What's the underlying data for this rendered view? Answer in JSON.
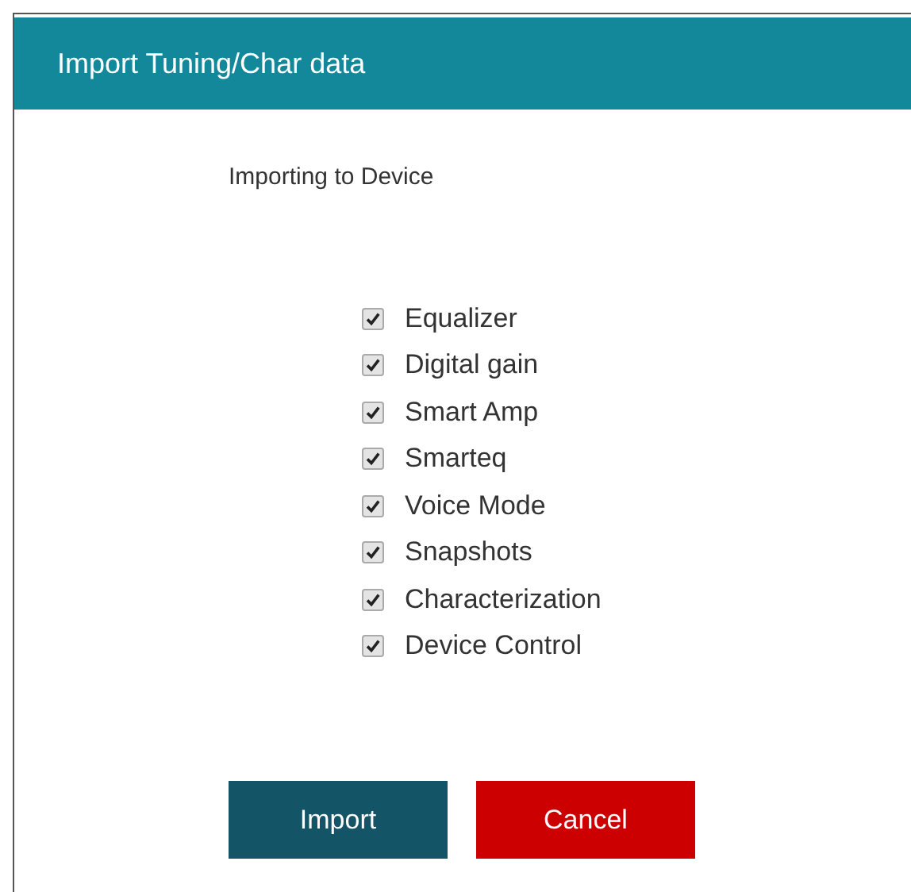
{
  "dialog": {
    "title": "Import Tuning/Char data"
  },
  "subtitle": "Importing to Device",
  "options": [
    {
      "label": "Equalizer",
      "checked": true
    },
    {
      "label": "Digital gain",
      "checked": true
    },
    {
      "label": "Smart Amp",
      "checked": true
    },
    {
      "label": "Smarteq",
      "checked": true
    },
    {
      "label": "Voice Mode",
      "checked": true
    },
    {
      "label": "Snapshots",
      "checked": true
    },
    {
      "label": "Characterization",
      "checked": true
    },
    {
      "label": "Device Control",
      "checked": true
    }
  ],
  "buttons": [
    {
      "label": "Import",
      "kind": "primary"
    },
    {
      "label": "Cancel",
      "kind": "danger"
    }
  ]
}
